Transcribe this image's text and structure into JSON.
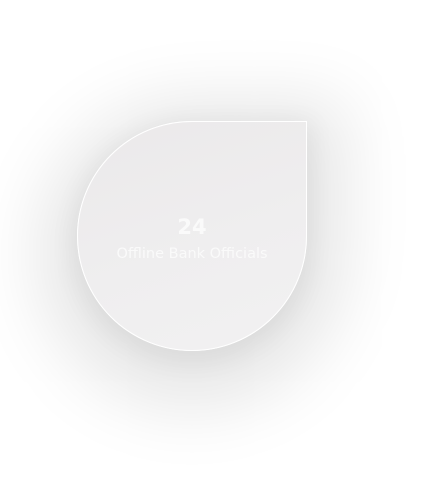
{
  "stat_card": {
    "value": "24",
    "label": "Offline Bank Officials"
  }
}
